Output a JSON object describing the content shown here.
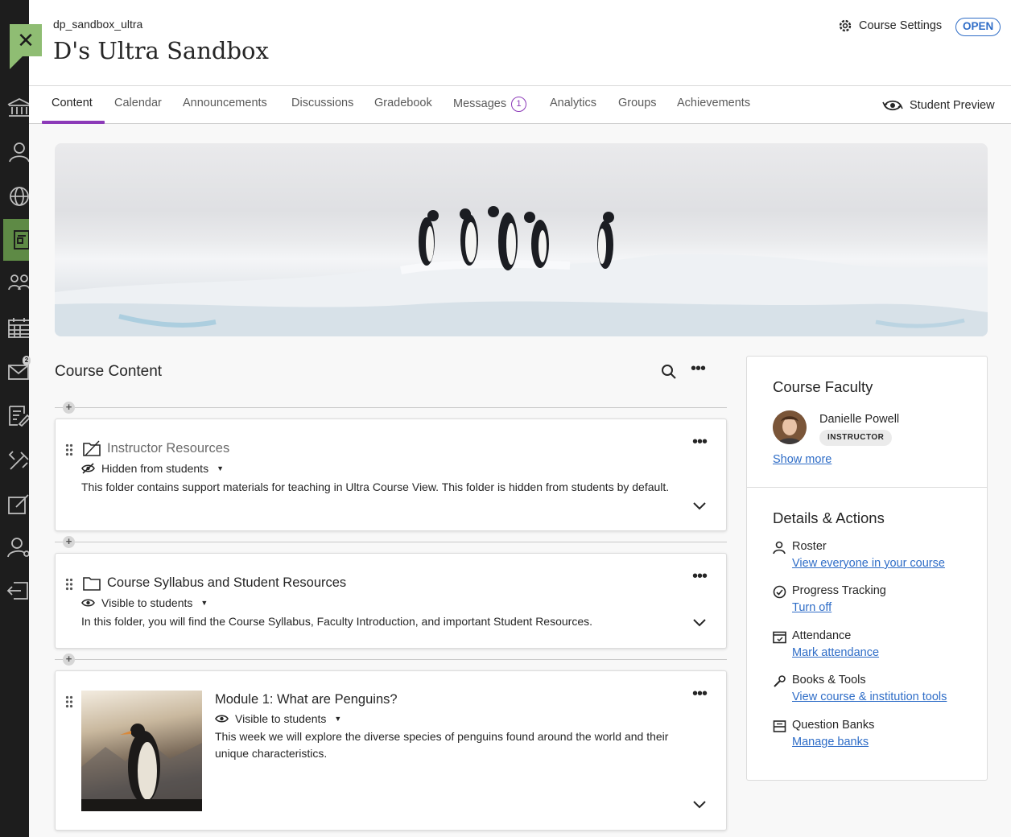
{
  "header": {
    "course_id": "dp_sandbox_ultra",
    "course_title": "D's Ultra Sandbox",
    "settings_label": "Course Settings",
    "status": "OPEN",
    "close_glyph": "✕"
  },
  "tabs": [
    {
      "label": "Content"
    },
    {
      "label": "Calendar"
    },
    {
      "label": "Announcements"
    },
    {
      "label": "Discussions"
    },
    {
      "label": "Gradebook"
    },
    {
      "label": "Messages",
      "badge": "1"
    },
    {
      "label": "Analytics"
    },
    {
      "label": "Groups"
    },
    {
      "label": "Achievements"
    }
  ],
  "student_preview_label": "Student Preview",
  "rail": {
    "icons": [
      "institution-icon",
      "profile-icon",
      "globe-icon",
      "courses-icon",
      "organizations-icon",
      "calendar-icon",
      "messages-icon",
      "grades-icon",
      "tools-icon",
      "notes-icon",
      "admin-icon",
      "sign-out-icon"
    ],
    "messages_badge": "2"
  },
  "course_content": {
    "title": "Course Content",
    "items": [
      {
        "title": "Instructor Resources",
        "visibility": "Hidden from students",
        "description": "This folder contains support materials for teaching in Ultra Course View. This folder is hidden from students by default."
      },
      {
        "title": "Course Syllabus and Student Resources",
        "visibility": "Visible to students",
        "description": "In this folder, you will find the Course Syllabus, Faculty Introduction, and important Student Resources."
      },
      {
        "title": "Module 1: What are Penguins?",
        "visibility": "Visible to students",
        "description": "This week we will explore the diverse species of penguins found around the world and their unique characteristics."
      }
    ]
  },
  "faculty": {
    "title": "Course Faculty",
    "name": "Danielle Powell",
    "role": "INSTRUCTOR",
    "show_more": "Show more"
  },
  "details": {
    "title": "Details & Actions",
    "items": [
      {
        "label": "Roster",
        "link": "View everyone in your course"
      },
      {
        "label": "Progress Tracking",
        "link": "Turn off"
      },
      {
        "label": "Attendance",
        "link": "Mark attendance"
      },
      {
        "label": "Books & Tools",
        "link": "View course & institution tools"
      },
      {
        "label": "Question Banks",
        "link": "Manage banks"
      }
    ]
  },
  "colors": {
    "accent": "#8c3ab8",
    "link": "#2f6dc7",
    "rail": "#1d1d1d",
    "rail_active": "#5e8a45",
    "close_tile": "#8fbd73"
  }
}
